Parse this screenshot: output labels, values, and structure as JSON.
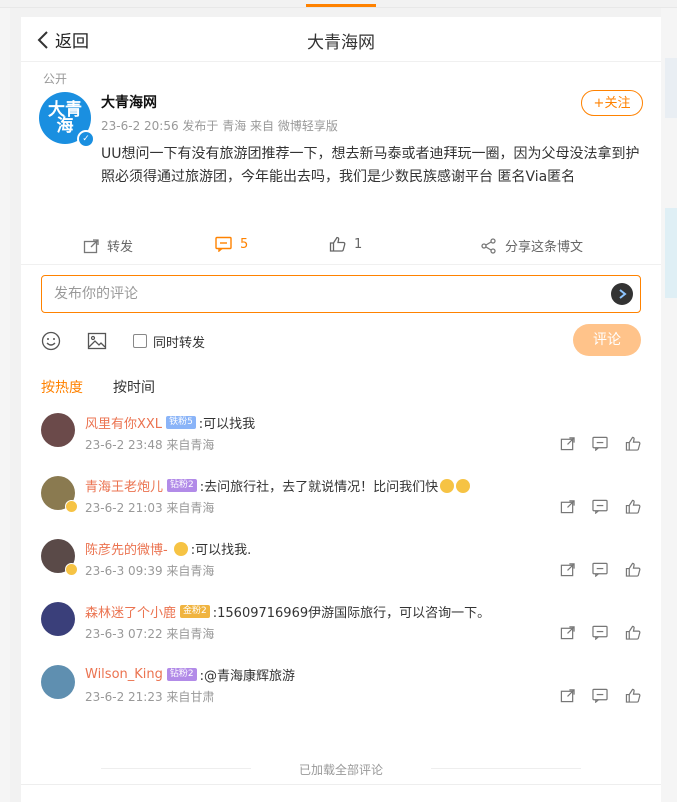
{
  "header": {
    "back_label": "返回",
    "title": "大青海网"
  },
  "post": {
    "visibility": "公开",
    "avatar_text": "大青海",
    "author": "大青海网",
    "meta": "23-6-2 20:56  发布于 青海  来自 微博轻享版",
    "follow_label": "+关注",
    "text": "UU想问一下有没有旅游团推荐一下，想去新马泰或者迪拜玩一圈，因为父母没法拿到护照必须得通过旅游团，今年能出去吗，我们是少数民族感谢平台 匿名Via匿名",
    "repost_label": "转发",
    "comment_count": "5",
    "like_count": "1",
    "share_label": "分享这条博文"
  },
  "comment_box": {
    "placeholder": "发布你的评论",
    "also_repost_label": "同时转发",
    "submit_label": "评论"
  },
  "sort": {
    "hot_label": "按热度",
    "time_label": "按时间"
  },
  "comments": [
    {
      "user": "风里有你XXL",
      "tag": "铁粉5",
      "text": ":可以找我",
      "time": "23-6-2 23:48 来自青海"
    },
    {
      "user": "青海王老炮儿",
      "tag": "钻粉2",
      "text": ":去问旅行社，去了就说情况！比问我们快",
      "time": "23-6-2 21:03 来自青海"
    },
    {
      "user": "陈彦先的微博-",
      "tag": "",
      "text": ":可以找我.",
      "time": "23-6-3 09:39 来自青海"
    },
    {
      "user": "森林迷了个小鹿",
      "tag": "金粉2",
      "text": ":15609716969伊游国际旅行，可以咨询一下。",
      "time": "23-6-3 07:22 来自青海"
    },
    {
      "user": "Wilson_King",
      "tag": "钻粉2",
      "text": ":@青海康辉旅游",
      "time": "23-6-2 21:23 来自甘肃"
    }
  ],
  "footer": {
    "loaded_label": "已加载全部评论"
  },
  "colors": {
    "accent": "#ff8200",
    "username": "#eb7350"
  }
}
